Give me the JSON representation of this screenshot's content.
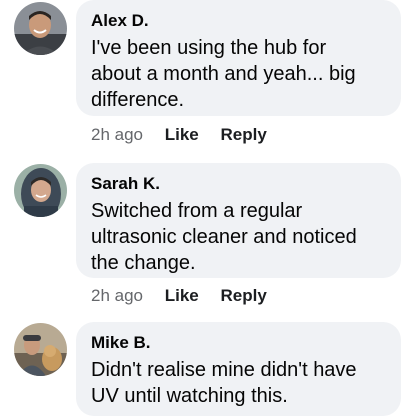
{
  "comments": [
    {
      "author": "Alex D.",
      "text": "I've been using the hub for\nabout a month and yeah... big\ndifference.",
      "time": "2h ago",
      "like_label": "Like",
      "reply_label": "Reply"
    },
    {
      "author": "Sarah K.",
      "text": "Switched from a regular\nultrasonic cleaner and noticed\nthe change.",
      "time": "2h ago",
      "like_label": "Like",
      "reply_label": "Reply"
    },
    {
      "author": "Mike B.",
      "text": "Didn't realise mine didn't have\nUV until watching this."
    }
  ]
}
